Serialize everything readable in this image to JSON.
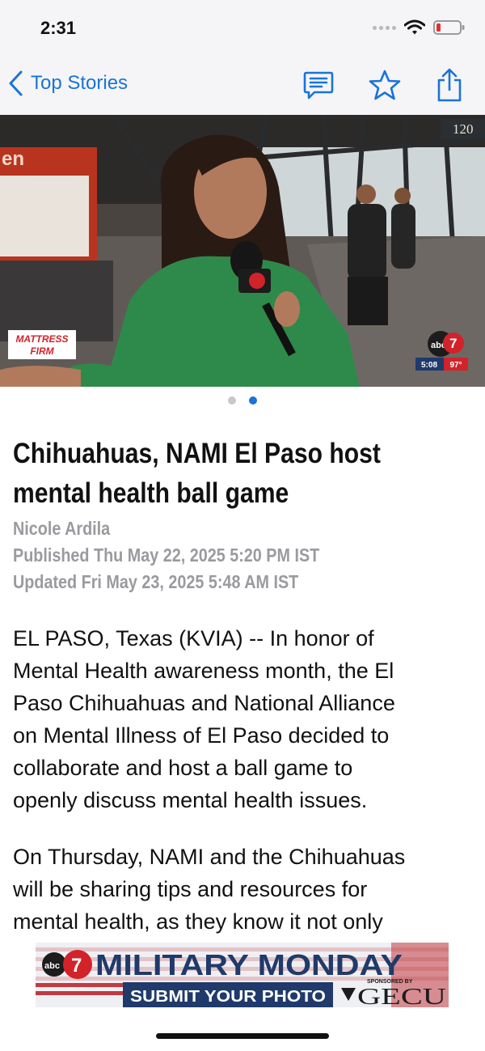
{
  "status_bar": {
    "time": "2:31"
  },
  "nav": {
    "back_label": "Top Stories",
    "icons": [
      "comment-icon",
      "star-icon",
      "share-icon"
    ]
  },
  "hero": {
    "sponsor_logo_line1": "MATTRESS",
    "sponsor_logo_line2": "FIRM",
    "station_logo": "abc",
    "station_number": "7",
    "bug_time": "5:08",
    "bug_temp": "97°",
    "scoreboard_text": "120"
  },
  "pager": {
    "count": 2,
    "active_index": 1
  },
  "article": {
    "headline": "Chihuahuas, NAMI El Paso host mental health ball game",
    "author": "Nicole Ardila",
    "published": "Published Thu May 22, 2025 5:20 PM IST",
    "updated": "Updated Fri May 23, 2025 5:48 AM IST",
    "paragraph1_lines": [
      "EL PASO, Texas (KVIA) -- In honor of",
      "Mental Health awareness month, the El",
      "Paso Chihuahuas and National Alliance",
      "on Mental Illness of El Paso decided to",
      "collaborate and host a ball game to",
      "openly discuss mental health issues."
    ],
    "paragraph2_lines": [
      "On Thursday, NAMI and the Chihuahuas",
      "will be sharing tips and resources for",
      "mental health, as they know it not only"
    ]
  },
  "ad": {
    "logo": "abc",
    "logo_number": "7",
    "title": "MILITARY MONDAY",
    "cta": "SUBMIT YOUR PHOTO",
    "sponsor_label": "SPONSORED BY",
    "sponsor_name": "GECU"
  },
  "colors": {
    "accent": "#1a73d9",
    "meta_gray": "#9a9a9f",
    "ad_navy": "#1f3a6b"
  }
}
